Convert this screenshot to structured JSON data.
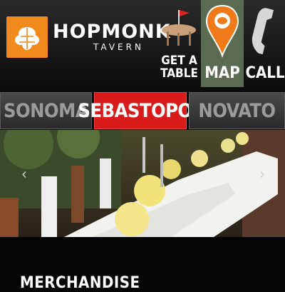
{
  "brand": {
    "name": "HOPMONK",
    "subtitle": "TAVERN"
  },
  "nav": [
    {
      "id": "get-table",
      "label": "GET A TABLE",
      "icon": "table-flag-icon"
    },
    {
      "id": "map",
      "label": "MAP",
      "icon": "map-pin-icon"
    },
    {
      "id": "call",
      "label": "CALL",
      "icon": "phone-icon"
    }
  ],
  "locations": [
    {
      "label": "SONOMA",
      "active": false
    },
    {
      "label": "SEBASTOPOL",
      "active": true
    },
    {
      "label": "NOVATO",
      "active": false
    }
  ],
  "carousel": {
    "prev_icon": "‹",
    "next_icon": "›"
  },
  "section": {
    "title": "MERCHANDISE"
  },
  "colors": {
    "accent": "#d91a1a",
    "logo": "#f08a1d",
    "map_pin": "#f07a1a"
  }
}
